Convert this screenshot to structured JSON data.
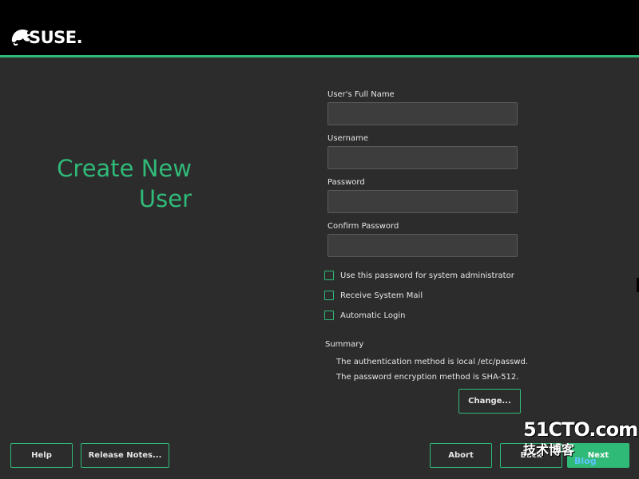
{
  "header": {
    "logo_text": "SUSE."
  },
  "page": {
    "title": "Create New\nUser"
  },
  "form": {
    "full_name_label": "User's Full Name",
    "full_name_value": "",
    "username_label": "Username",
    "username_value": "",
    "password_label": "Password",
    "password_value": "",
    "confirm_password_label": "Confirm Password",
    "confirm_password_value": ""
  },
  "options": {
    "use_for_admin_label": "Use this password for system administrator",
    "use_for_admin_checked": false,
    "receive_mail_label": "Receive System Mail",
    "receive_mail_checked": false,
    "auto_login_label": "Automatic Login",
    "auto_login_checked": false
  },
  "summary": {
    "title": "Summary",
    "line1": "The authentication method is local /etc/passwd.",
    "line2": "The password encryption method is SHA-512.",
    "change_label": "Change..."
  },
  "footer": {
    "help_label": "Help",
    "release_notes_label": "Release Notes...",
    "abort_label": "Abort",
    "back_label": "Back",
    "next_label": "Next"
  },
  "watermark": {
    "top": "51CTO.com",
    "bottom": "技术博客",
    "url": "Blog"
  },
  "colors": {
    "accent": "#30ba78",
    "background": "#2c2c2c",
    "header": "#000000",
    "input_bg": "#3d3d3d"
  }
}
